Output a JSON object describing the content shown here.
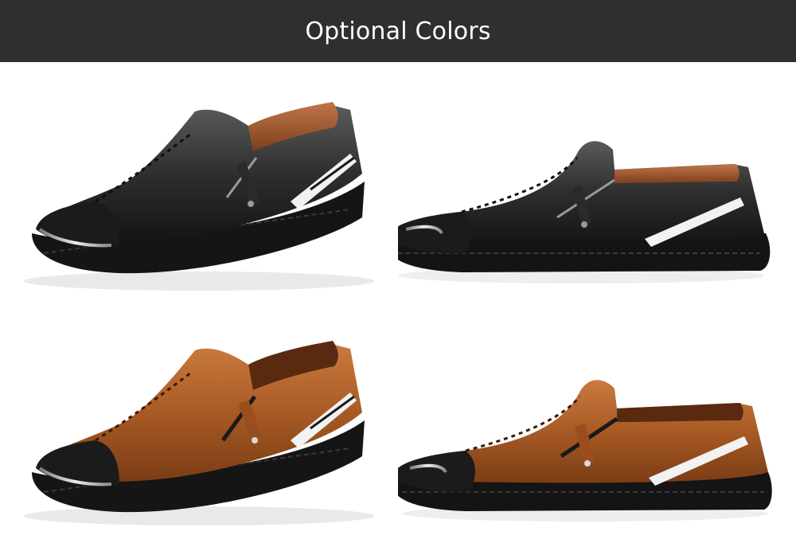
{
  "header": {
    "title": "Optional Colors",
    "background": "#2d2f31",
    "text_color": "#ffffff"
  },
  "photos": [
    {
      "label": "black-shoe-angled",
      "color": "#2f2f2f",
      "icon": "shoe-photo"
    },
    {
      "label": "black-shoe-side",
      "color": "#262626",
      "icon": "shoe-photo"
    },
    {
      "label": "brown-shoe-angled",
      "color": "#b5652d",
      "icon": "shoe-photo"
    },
    {
      "label": "brown-shoe-side",
      "color": "#b0622c",
      "icon": "shoe-photo"
    }
  ]
}
